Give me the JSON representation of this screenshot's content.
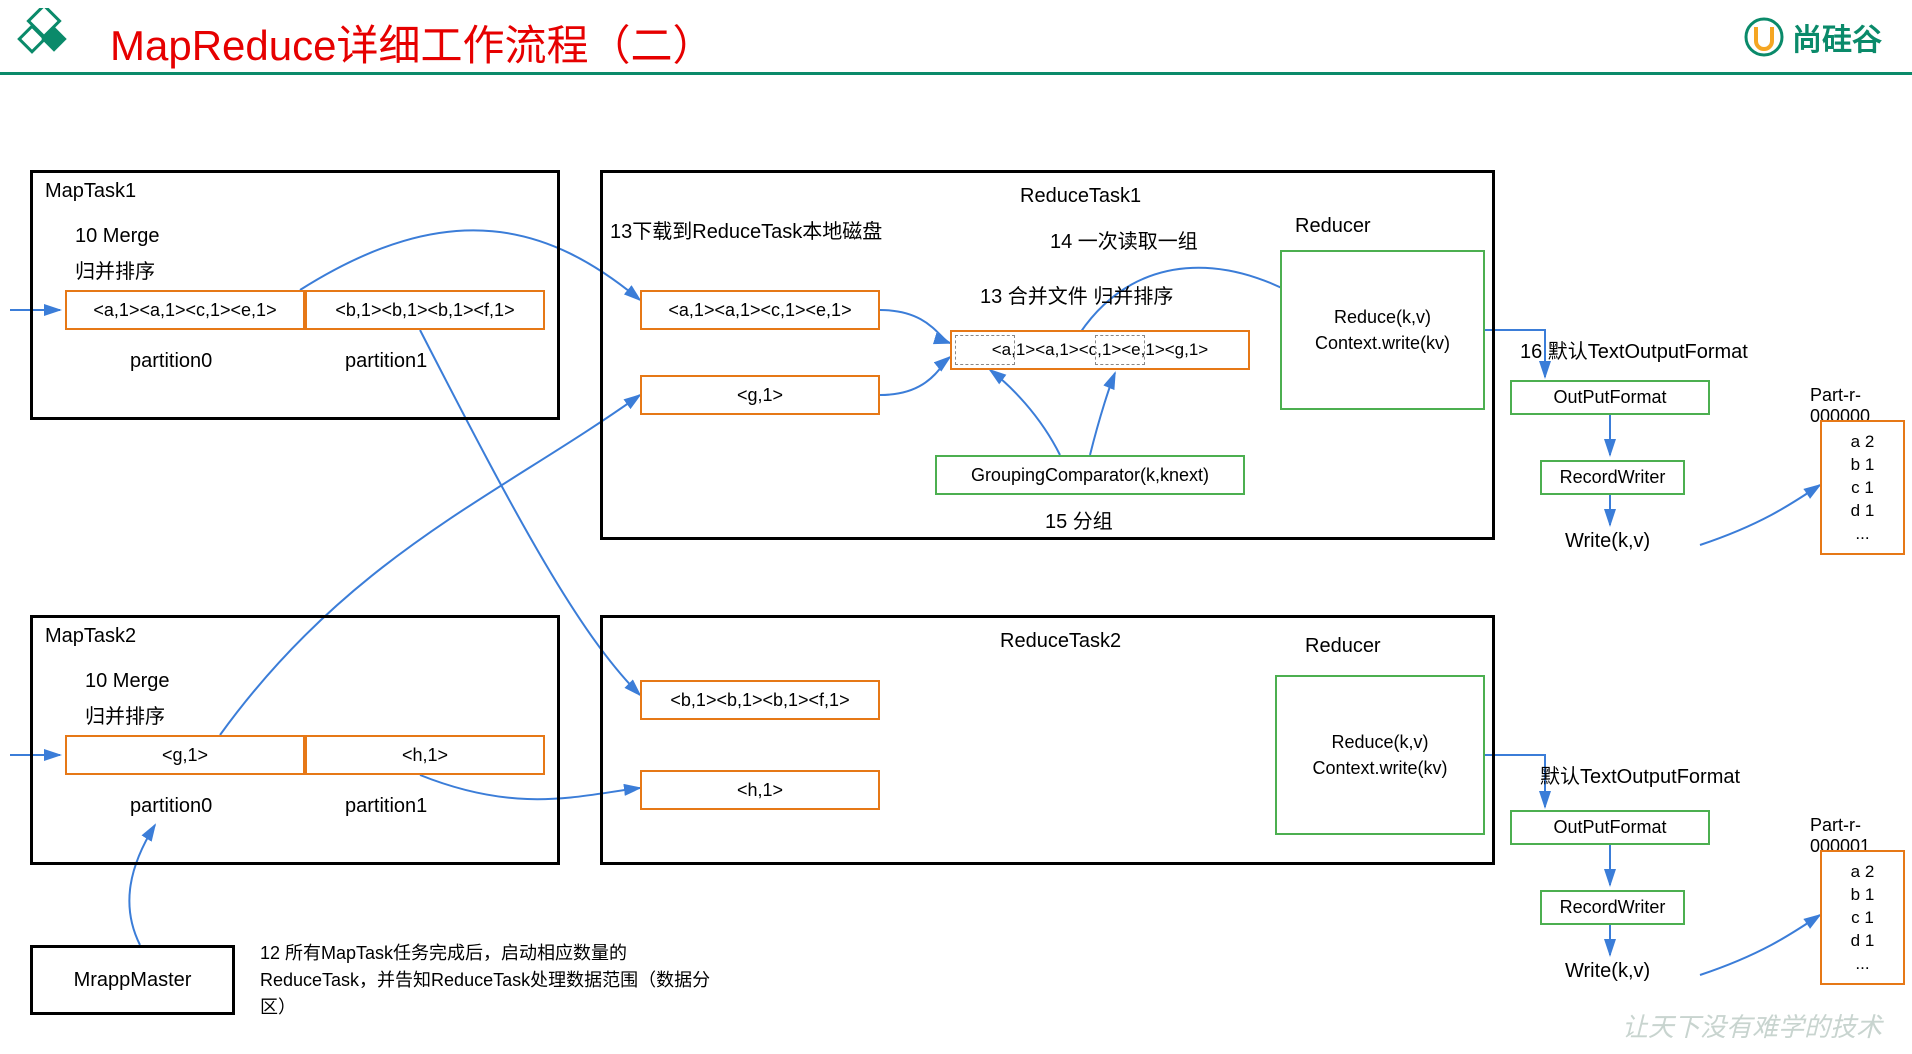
{
  "header": {
    "title": "MapReduce详细工作流程（二）",
    "brand": "尚硅谷"
  },
  "maptask1": {
    "title": "MapTask1",
    "merge": "10 Merge",
    "sort": "归并排序",
    "p0": "<a,1><a,1><c,1><e,1>",
    "p1": "<b,1><b,1><b,1><f,1>",
    "p0lbl": "partition0",
    "p1lbl": "partition1"
  },
  "maptask2": {
    "title": "MapTask2",
    "merge": "10 Merge",
    "sort": "归并排序",
    "p0": "<g,1>",
    "p1": "<h,1>",
    "p0lbl": "partition0",
    "p1lbl": "partition1"
  },
  "master": {
    "title": "MrappMaster",
    "note": "12 所有MapTask任务完成后，启动相应数量的ReduceTask，并告知ReduceTask处理数据范围（数据分区）"
  },
  "reducetask1": {
    "title": "ReduceTask1",
    "step13": "13下载到ReduceTask本地磁盘",
    "step14": "14 一次读取一组",
    "step13b": "13 合并文件 归并排序",
    "step15": "15 分组",
    "step16": "16 默认TextOutputFormat",
    "reducer": "Reducer",
    "reduce_fn": "Reduce(k,v)",
    "context": "Context.write(kv)",
    "grouping": "GroupingComparator(k,knext)",
    "d1": "<a,1><a,1><c,1><e,1>",
    "d2": "<g,1>",
    "merged": "<a,1><a,1><c,1><e,1><g,1>",
    "outputformat": "OutPutFormat",
    "recordwriter": "RecordWriter",
    "write": "Write(k,v)",
    "partfile": "Part-r-000000",
    "out_a": "a 2",
    "out_b": "b 1",
    "out_c": "c 1",
    "out_d": "d 1",
    "out_e": "..."
  },
  "reducetask2": {
    "title": "ReduceTask2",
    "reducer": "Reducer",
    "reduce_fn": "Reduce(k,v)",
    "context": "Context.write(kv)",
    "d1": "<b,1><b,1><b,1><f,1>",
    "d2": "<h,1>",
    "step16": "默认TextOutputFormat",
    "outputformat": "OutPutFormat",
    "recordwriter": "RecordWriter",
    "write": "Write(k,v)",
    "partfile": "Part-r-000001",
    "out_a": "a 2",
    "out_b": "b 1",
    "out_c": "c 1",
    "out_d": "d 1",
    "out_e": "..."
  }
}
